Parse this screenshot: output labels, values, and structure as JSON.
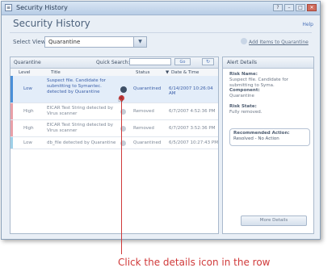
{
  "window": {
    "title": "Security History",
    "controls": [
      "help",
      "minimize",
      "maximize",
      "close"
    ]
  },
  "header": {
    "page_title": "Security History",
    "help_label": "Help"
  },
  "filter": {
    "select_view_label": "Select View:",
    "selected_view": "Quarantine",
    "add_items_label": "Add Items to Quarantine"
  },
  "list_panel": {
    "label": "Quarantine",
    "quick_search_label": "Quick Search:",
    "go_label": "Go",
    "columns": {
      "level": "Level",
      "title": "Title",
      "status": "Status",
      "datetime": "Date & Time"
    },
    "rows": [
      {
        "level": "Low",
        "title": "Suspect file. Candidate for submitting to Symantec. detected by Quarantine",
        "status": "Quarantined",
        "datetime": "6/14/2007 10:26:04 AM",
        "selected": true,
        "level_color": "#4a8fd8"
      },
      {
        "level": "High",
        "title": "EICAR Test String detected by Virus scanner",
        "status": "Removed",
        "datetime": "6/7/2007 4:52:36 PM",
        "selected": false,
        "level_color": "#e9a0a8"
      },
      {
        "level": "High",
        "title": "EICAR Test String detected by Virus scanner",
        "status": "Removed",
        "datetime": "6/7/2007 3:52:36 PM",
        "selected": false,
        "level_color": "#e9a0a8"
      },
      {
        "level": "Low",
        "title": "db_file detected by Quarantine",
        "status": "Quarantined",
        "datetime": "6/5/2007 10:27:43 PM",
        "selected": false,
        "level_color": "#9fd0e8"
      }
    ]
  },
  "details_panel": {
    "header": "Alert Details",
    "risk_name_label": "Risk Name:",
    "risk_name_value": "Suspect file. Candidate for submitting to Syma.",
    "component_label": "Component:",
    "component_value": "Quarantine",
    "risk_state_label": "Risk State:",
    "risk_state_value": "Fully removed.",
    "recommended_label": "Recommended Action:",
    "recommended_value": "Resolved - No Action",
    "more_details_label": "More Details"
  },
  "annotation": {
    "caption": "Click the details icon in the row",
    "color": "#d03a3a"
  }
}
